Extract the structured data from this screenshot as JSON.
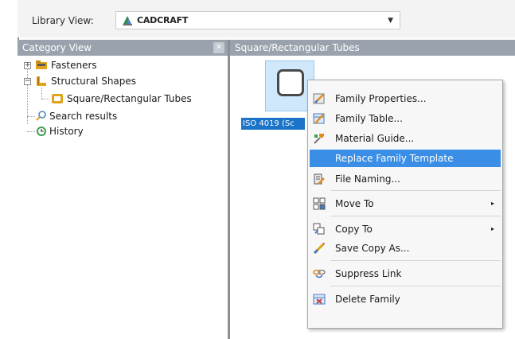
{
  "toolbar": {
    "library_view_label": "Library View:",
    "library_value": "CADCRAFT"
  },
  "category_panel": {
    "title": "Category View",
    "tree": [
      {
        "label": "Fasteners",
        "expander": "+"
      },
      {
        "label": "Structural Shapes",
        "expander": "−"
      },
      {
        "label": "Square/Rectangular Tubes"
      },
      {
        "label": "Search results"
      },
      {
        "label": "History"
      }
    ]
  },
  "content_panel": {
    "title": "Square/Rectangular Tubes",
    "selected_item_caption": "ISO 4019 (Sc"
  },
  "context_menu": {
    "items": [
      {
        "label": "Family Properties...",
        "icon": "family-properties-icon"
      },
      {
        "label": "Family Table...",
        "icon": "family-table-icon"
      },
      {
        "label": "Material Guide...",
        "icon": "material-guide-icon"
      },
      {
        "label": "Replace Family Template",
        "icon": "",
        "highlighted": true
      },
      {
        "label": "File Naming...",
        "icon": "file-naming-icon"
      },
      {
        "label": "Move To",
        "icon": "move-to-icon",
        "submenu": true
      },
      {
        "label": "Copy To",
        "icon": "copy-to-icon",
        "submenu": true
      },
      {
        "label": "Save Copy As...",
        "icon": "save-copy-icon"
      },
      {
        "label": "Suppress Link",
        "icon": "suppress-link-icon"
      },
      {
        "label": "Delete Family",
        "icon": "delete-family-icon"
      }
    ],
    "submenu_arrow": "▸"
  },
  "colors": {
    "panel_header": "#9aa3ad",
    "selection": "#1b74c7",
    "menu_highlight": "#3a8ee6"
  }
}
